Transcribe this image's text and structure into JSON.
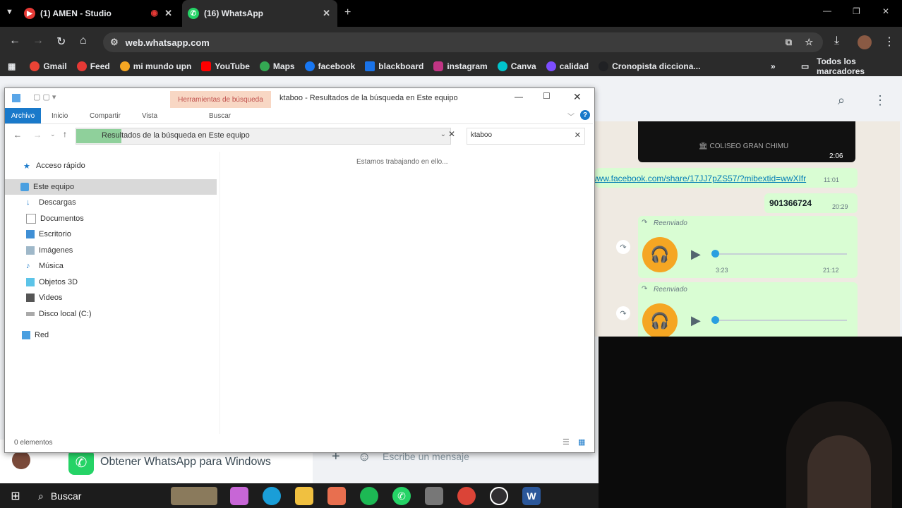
{
  "browser": {
    "tabs": [
      {
        "title": "(1) AMEN - Studio",
        "active": false
      },
      {
        "title": "(16) WhatsApp",
        "active": true
      }
    ],
    "url": "web.whatsapp.com",
    "bookmarks": [
      {
        "label": "Gmail",
        "color": "#ea4335"
      },
      {
        "label": "Feed",
        "color": "#e53935"
      },
      {
        "label": "mi mundo upn",
        "color": "#f5a623"
      },
      {
        "label": "YouTube",
        "color": "#ff0000"
      },
      {
        "label": "Maps",
        "color": "#34a853"
      },
      {
        "label": "facebook",
        "color": "#1877f2"
      },
      {
        "label": "blackboard",
        "color": "#1a73e8"
      },
      {
        "label": "instagram",
        "color": "#c13584"
      },
      {
        "label": "Canva",
        "color": "#00c4cc"
      },
      {
        "label": "calidad",
        "color": "#7c4dff"
      },
      {
        "label": "Cronopista dicciona...",
        "color": "#202124"
      }
    ],
    "all_bookmarks": "Todos los marcadores"
  },
  "explorer": {
    "ribbon_context": "Herramientas de búsqueda",
    "window_title": "ktaboo - Resultados de la búsqueda en Este equipo",
    "tabs": {
      "file": "Archivo",
      "home": "Inicio",
      "share": "Compartir",
      "view": "Vista",
      "search": "Buscar"
    },
    "address": "Resultados de la búsqueda en Este equipo",
    "search_value": "ktaboo",
    "working_message": "Estamos trabajando en ello...",
    "nav": {
      "quick_access": "Acceso rápido",
      "this_pc": "Este equipo",
      "items": [
        "Descargas",
        "Documentos",
        "Escritorio",
        "Imágenes",
        "Música",
        "Objetos 3D",
        "Videos",
        "Disco local (C:)"
      ],
      "network": "Red"
    },
    "status": "0 elementos"
  },
  "whatsapp": {
    "video_caption_time": "2:06",
    "link_text": "www.facebook.com/share/17JJ7pZS57/?mibextid=wwXIfr",
    "link_time": "11:01",
    "phone": "901366724",
    "phone_time": "20:29",
    "forwarded_label": "Reenviado",
    "audio1_duration": "3:23",
    "audio1_time": "21:12",
    "get_app": "Obtener WhatsApp para Windows",
    "composer_placeholder": "Escribe un mensaje"
  },
  "taskbar": {
    "search_label": "Buscar"
  },
  "colors": {
    "accent_green": "#25d366",
    "audio_orange": "#f5a623",
    "explorer_blue": "#1979ca"
  }
}
